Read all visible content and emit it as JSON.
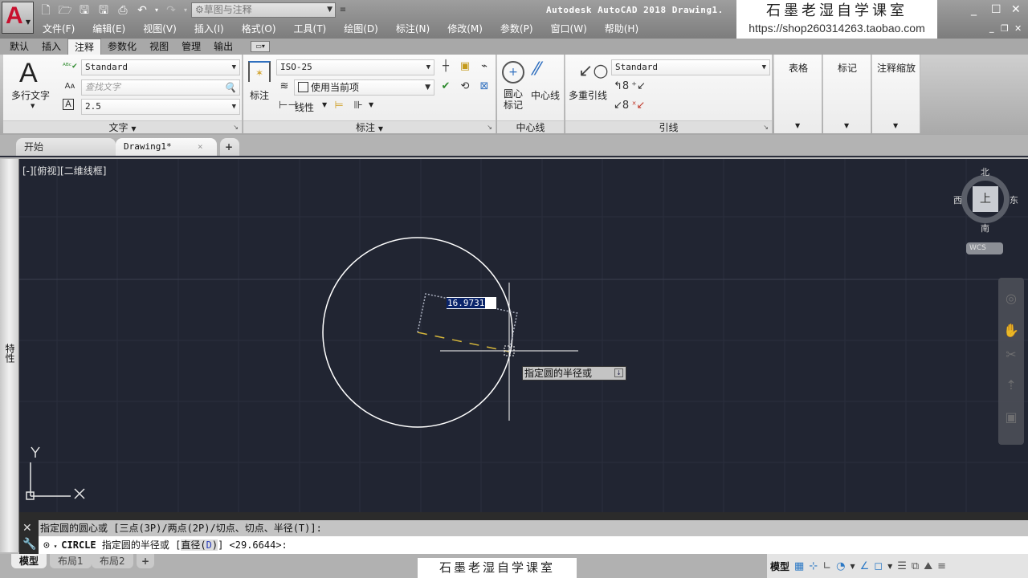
{
  "titlebar": {
    "app_logo": "A",
    "workspace": "草图与注释",
    "title": "Autodesk AutoCAD 2018    Drawing1.",
    "qat_icons": [
      "new-icon",
      "open-icon",
      "save-icon",
      "save-as-icon",
      "plot-icon",
      "undo-icon",
      "redo-icon"
    ],
    "win_controls": {
      "minimize": "_",
      "maximize": "☐",
      "close": "✕",
      "doc_minimize": "_",
      "doc_restore": "❐",
      "doc_close": "✕"
    }
  },
  "watermark": {
    "title": "石墨老湿自学课室",
    "url": "https://shop260314263.taobao.com",
    "bottom": "石墨老湿自学课室"
  },
  "menubar": [
    "文件(F)",
    "编辑(E)",
    "视图(V)",
    "插入(I)",
    "格式(O)",
    "工具(T)",
    "绘图(D)",
    "标注(N)",
    "修改(M)",
    "参数(P)",
    "窗口(W)",
    "帮助(H)"
  ],
  "ribbon_tabs": [
    "默认",
    "插入",
    "注释",
    "参数化",
    "视图",
    "管理",
    "输出"
  ],
  "ribbon_active_tab": "注释",
  "ribbon": {
    "text_panel": {
      "title": "文字",
      "big_button": "多行文字",
      "style": "Standard",
      "find_placeholder": "查找文字",
      "height": "2.5"
    },
    "dim_panel": {
      "title": "标注",
      "big_button": "标注",
      "style": "ISO-25",
      "layer": "使用当前项",
      "linear": "线性"
    },
    "centerline_panel": {
      "title": "中心线",
      "center_mark": "圆心\n标记",
      "center_mark_line1": "圆心",
      "center_mark_line2": "标记",
      "centerline": "中心线"
    },
    "leader_panel": {
      "title": "引线",
      "big_button": "多重引线",
      "style": "Standard"
    },
    "collapsed_panels": [
      "表格",
      "标记",
      "注释缩放"
    ]
  },
  "doc_tabs": [
    {
      "label": "开始",
      "active": false
    },
    {
      "label": "Drawing1*",
      "active": true
    }
  ],
  "doc_tab_close": "×",
  "doc_tab_add": "+",
  "palette": {
    "label": "特性"
  },
  "canvas": {
    "viewport_label": "[-][俯视][二维线框]",
    "viewcube": {
      "north": "北",
      "south": "南",
      "east": "东",
      "west": "西",
      "face": "上",
      "ucs": "WCS"
    },
    "dynamic_input_value": "16.9731",
    "prompt_tip": "指定圆的半径或",
    "ucs_x": "X",
    "ucs_y": "Y",
    "colors": {
      "background": "#212532",
      "circle": "#ffffff",
      "radius_line": "#d4b53a"
    }
  },
  "command": {
    "history": "指定圆的圆心或 [三点(3P)/两点(2P)/切点、切点、半径(T)]:",
    "command_name": "CIRCLE",
    "prompt": "指定圆的半径或",
    "option_prefix": "[",
    "option_label": "直径(",
    "option_key": "D",
    "option_suffix": ")",
    "option_close": "]",
    "default": "<29.6644>:"
  },
  "layout_tabs": [
    "模型",
    "布局1",
    "布局2"
  ],
  "layout_add": "+",
  "statusbar": {
    "model_label": "模型",
    "icons": [
      "grid-icon",
      "snap-icon",
      "ortho-icon",
      "polar-icon",
      "isodraft-icon",
      "osnap-icon",
      "lineweight-icon",
      "selection-cycling-icon",
      "annotation-monitor-icon",
      "customize-icon"
    ]
  }
}
